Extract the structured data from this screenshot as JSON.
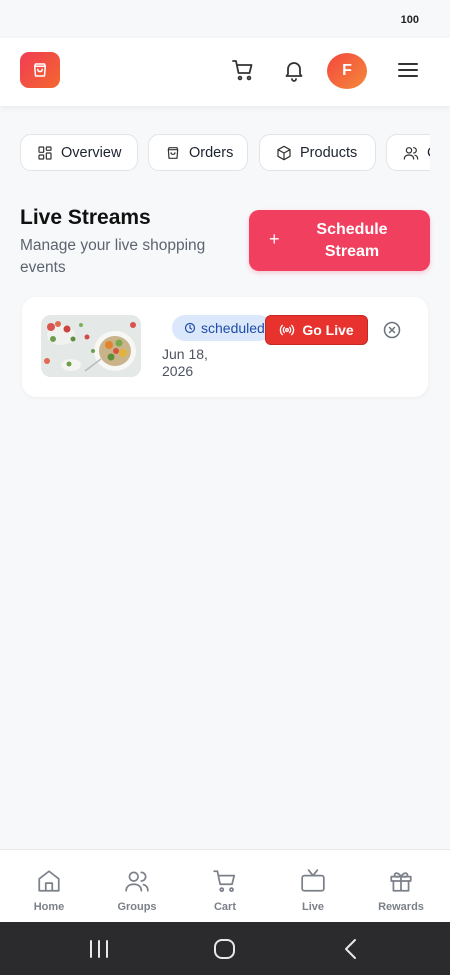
{
  "status_bar": {
    "battery": "100"
  },
  "header": {
    "logo_icon": "shopping-bag-icon",
    "avatar_initial": "F",
    "icons": [
      "cart-icon",
      "bell-icon",
      "menu-icon"
    ],
    "colors": {
      "brand_start": "#f23b54",
      "brand_end": "#f3682f"
    }
  },
  "tabs": [
    {
      "label": "Overview",
      "icon": "dashboard-icon"
    },
    {
      "label": "Orders",
      "icon": "bag-icon"
    },
    {
      "label": "Products",
      "icon": "box-icon"
    },
    {
      "label": "C",
      "icon": "users-icon"
    }
  ],
  "page": {
    "title": "Live Streams",
    "subtitle": "Manage your live shopping events",
    "schedule_button": {
      "icon": "plus",
      "label": "Schedule Stream"
    }
  },
  "streams": [
    {
      "status": "scheduled",
      "status_icon": "clock-icon",
      "go_live_label": "Go Live",
      "date": "Jun 18, 2026",
      "thumbnail": "salad-bowl-food-image",
      "colors": {
        "status_bg": "#dbe8fb",
        "status_text": "#1f4ca8",
        "go_live": "#e8322e"
      }
    }
  ],
  "bottom_nav": [
    {
      "label": "Home",
      "icon": "home-icon"
    },
    {
      "label": "Groups",
      "icon": "users-icon"
    },
    {
      "label": "Cart",
      "icon": "cart-icon"
    },
    {
      "label": "Live",
      "icon": "tv-icon"
    },
    {
      "label": "Rewards",
      "icon": "gift-icon"
    }
  ],
  "accent_color": "#f03f5f"
}
